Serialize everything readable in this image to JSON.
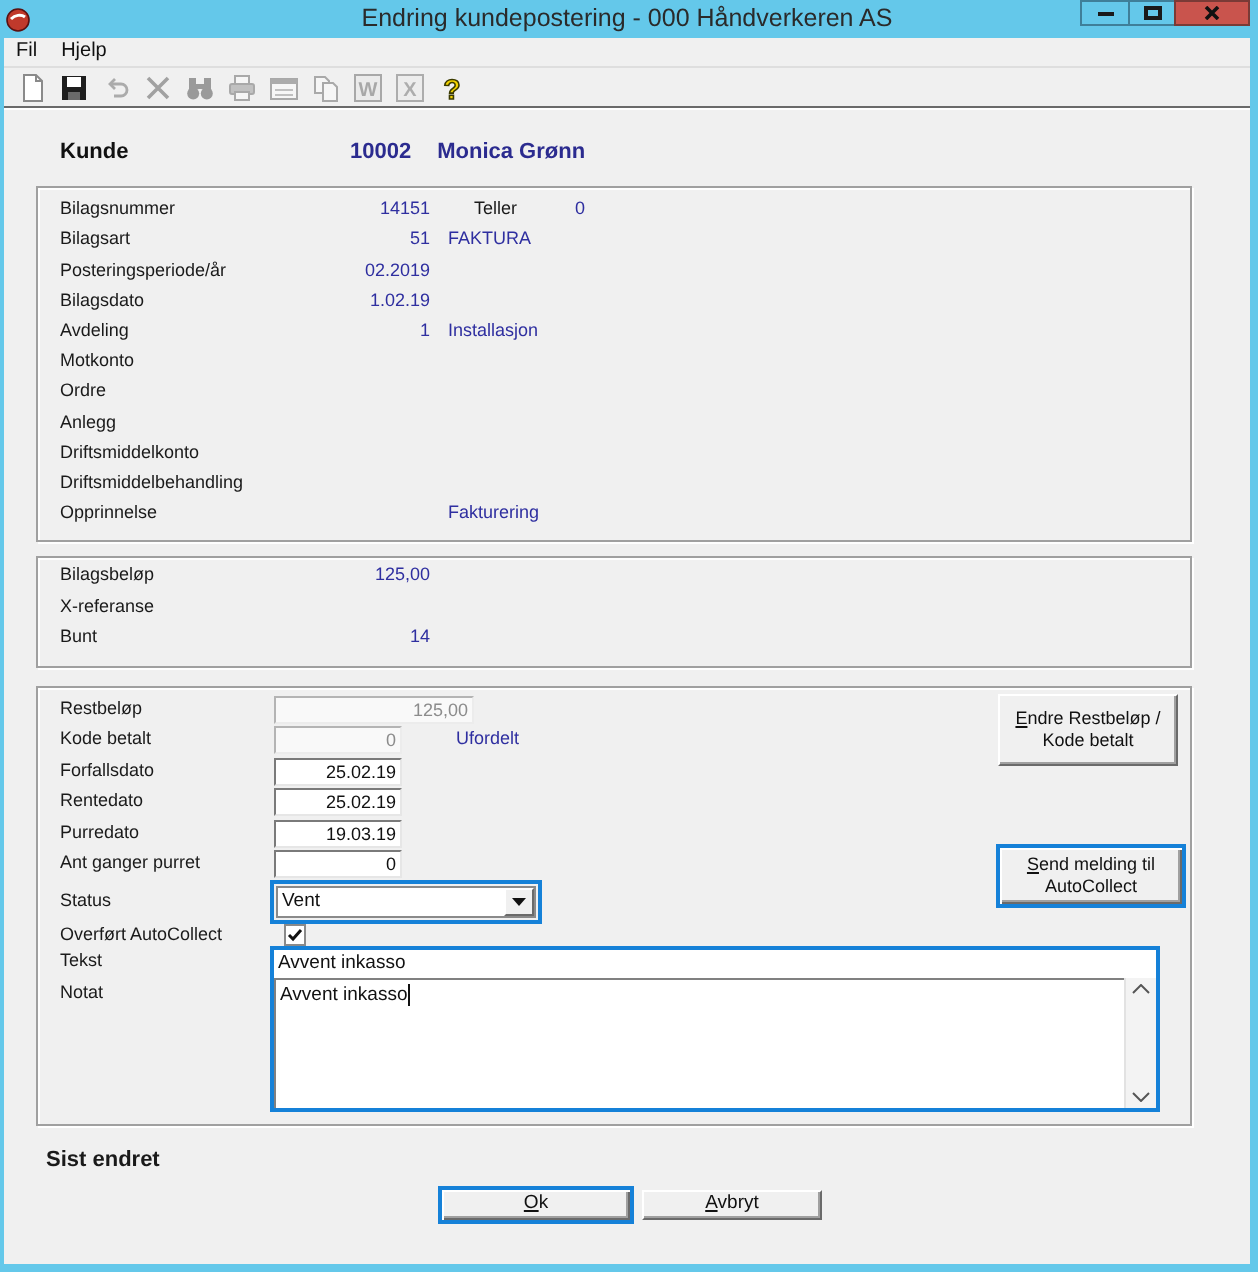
{
  "window": {
    "title": "Endring kundepostering - 000 Håndverkeren AS"
  },
  "menu": [
    {
      "label": "Fil"
    },
    {
      "label": "Hjelp"
    }
  ],
  "toolbar": [
    {
      "kind": "new",
      "disabled": false
    },
    {
      "kind": "save",
      "disabled": false
    },
    {
      "kind": "undo",
      "disabled": true
    },
    {
      "kind": "delete",
      "disabled": true
    },
    {
      "kind": "find",
      "disabled": true
    },
    {
      "kind": "print",
      "disabled": true
    },
    {
      "kind": "form",
      "disabled": true
    },
    {
      "kind": "copy",
      "disabled": true
    },
    {
      "kind": "word",
      "glyph": "W",
      "disabled": true
    },
    {
      "kind": "excel",
      "glyph": "X",
      "disabled": true
    },
    {
      "kind": "help",
      "glyph": "?",
      "disabled": false
    }
  ],
  "customer": {
    "label": "Kunde",
    "number": "10002",
    "name": "Monica Grønn"
  },
  "document_fields": [
    {
      "label": "Bilagsnummer",
      "value": "14151",
      "secondary_label": "Teller",
      "secondary_value": "0"
    },
    {
      "label": "Bilagsart",
      "value": "51",
      "description": "FAKTURA"
    },
    {
      "label": "Posteringsperiode/år",
      "value": "02.2019"
    },
    {
      "label": "Bilagsdato",
      "value": "1.02.19"
    },
    {
      "label": "Avdeling",
      "value": "1",
      "description": "Installasjon"
    },
    {
      "label": "Motkonto"
    },
    {
      "label": "Ordre"
    },
    {
      "label": "Anlegg"
    },
    {
      "label": "Driftsmiddelkonto"
    },
    {
      "label": "Driftsmiddelbehandling"
    },
    {
      "label": "Opprinnelse",
      "description": "Fakturering"
    }
  ],
  "amount_fields": [
    {
      "label": "Bilagsbeløp",
      "value": "125,00"
    },
    {
      "label": "X-referanse"
    },
    {
      "label": "Bunt",
      "value": "14"
    }
  ],
  "payment_fields": [
    {
      "kind": "input",
      "label": "Restbeløp",
      "value": "125,00",
      "disabled": true,
      "highlighted": false
    },
    {
      "kind": "input",
      "label": "Kode betalt",
      "value": "0",
      "disabled": true,
      "highlighted": false,
      "note": "Ufordelt"
    },
    {
      "kind": "input",
      "label": "Forfallsdato",
      "value": "25.02.19",
      "disabled": false,
      "highlighted": false
    },
    {
      "kind": "input",
      "label": "Rentedato",
      "value": "25.02.19",
      "disabled": false,
      "highlighted": false
    },
    {
      "kind": "input",
      "label": "Purredato",
      "value": "19.03.19",
      "disabled": false,
      "highlighted": false
    },
    {
      "kind": "input",
      "label": "Ant ganger purret",
      "value": "0",
      "disabled": false,
      "highlighted": false
    },
    {
      "kind": "select",
      "label": "Status",
      "value": "Vent",
      "highlighted": true
    },
    {
      "kind": "checkbox",
      "label": "Overført AutoCollect",
      "checked": true,
      "highlighted": false
    },
    {
      "kind": "text",
      "label": "Tekst",
      "value": "Avvent inkasso",
      "highlighted": true
    },
    {
      "kind": "textarea",
      "label": "Notat",
      "value": "Avvent inkasso",
      "highlighted": true
    }
  ],
  "side_buttons": [
    {
      "label": "Endre Restbeløp / Kode betalt",
      "access_key_underlined": true,
      "highlighted": false
    },
    {
      "label": "Send melding til AutoCollect",
      "access_key_underlined": true,
      "highlighted": true
    }
  ],
  "last_changed_label": "Sist endret",
  "buttons": [
    {
      "label": "Ok",
      "access_key_underlined": true,
      "highlighted": true
    },
    {
      "label": "Avbryt",
      "access_key_underlined": true,
      "highlighted": false
    }
  ]
}
